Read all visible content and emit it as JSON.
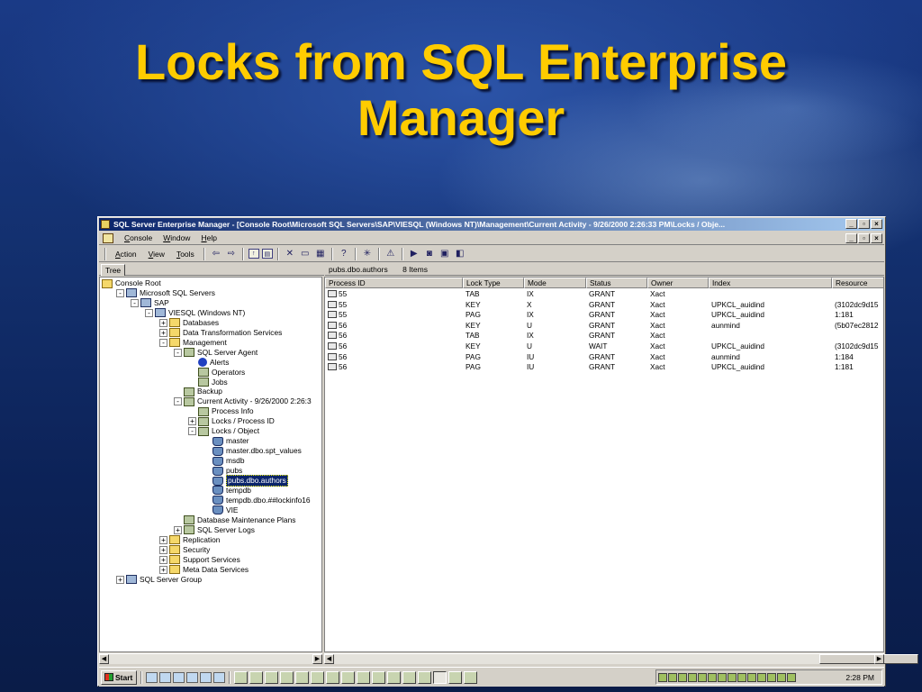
{
  "slide": {
    "title_line1": "Locks from SQL Enterprise",
    "title_line2": "Manager"
  },
  "window": {
    "title": "SQL Server Enterprise Manager - [Console Root\\Microsoft SQL Servers\\SAP\\VIESQL (Windows NT)\\Management\\Current Activity - 9/26/2000 2:26:33 PM\\Locks / Obje...",
    "menus": [
      "Console",
      "Window",
      "Help"
    ],
    "toolbar_menus": [
      "Action",
      "View",
      "Tools"
    ],
    "tree_tab": "Tree",
    "list_header": {
      "object": "pubs.dbo.authors",
      "count": "8 Items"
    }
  },
  "tree": [
    {
      "label": "Console Root",
      "depth": 0,
      "expander": "",
      "icon": "folder-icon"
    },
    {
      "label": "Microsoft SQL Servers",
      "depth": 1,
      "expander": "−",
      "icon": "server-group-icon"
    },
    {
      "label": "SAP",
      "depth": 2,
      "expander": "−",
      "icon": "server-group-icon"
    },
    {
      "label": "VIESQL (Windows NT)",
      "depth": 3,
      "expander": "−",
      "icon": "server-icon"
    },
    {
      "label": "Databases",
      "depth": 4,
      "expander": "+",
      "icon": "folder-icon"
    },
    {
      "label": "Data Transformation Services",
      "depth": 4,
      "expander": "+",
      "icon": "folder-icon"
    },
    {
      "label": "Management",
      "depth": 4,
      "expander": "−",
      "icon": "folder-icon"
    },
    {
      "label": "SQL Server Agent",
      "depth": 5,
      "expander": "−",
      "icon": "agent-icon"
    },
    {
      "label": "Alerts",
      "depth": 6,
      "expander": "",
      "icon": "alert-icon"
    },
    {
      "label": "Operators",
      "depth": 6,
      "expander": "",
      "icon": "operators-icon"
    },
    {
      "label": "Jobs",
      "depth": 6,
      "expander": "",
      "icon": "jobs-icon"
    },
    {
      "label": "Backup",
      "depth": 5,
      "expander": "",
      "icon": "backup-icon"
    },
    {
      "label": "Current Activity - 9/26/2000 2:26:3",
      "depth": 5,
      "expander": "−",
      "icon": "activity-icon"
    },
    {
      "label": "Process Info",
      "depth": 6,
      "expander": "",
      "icon": "process-info-icon"
    },
    {
      "label": "Locks / Process ID",
      "depth": 6,
      "expander": "+",
      "icon": "locks-icon"
    },
    {
      "label": "Locks / Object",
      "depth": 6,
      "expander": "−",
      "icon": "locks-icon"
    },
    {
      "label": "master",
      "depth": 7,
      "expander": "",
      "icon": "table-lock-icon"
    },
    {
      "label": "master.dbo.spt_values",
      "depth": 7,
      "expander": "",
      "icon": "table-lock-icon"
    },
    {
      "label": "msdb",
      "depth": 7,
      "expander": "",
      "icon": "table-lock-icon"
    },
    {
      "label": "pubs",
      "depth": 7,
      "expander": "",
      "icon": "table-lock-icon"
    },
    {
      "label": "pubs.dbo.authors",
      "depth": 7,
      "expander": "",
      "icon": "table-lock-icon",
      "selected": true
    },
    {
      "label": "tempdb",
      "depth": 7,
      "expander": "",
      "icon": "table-lock-icon"
    },
    {
      "label": "tempdb.dbo.##lockinfo16",
      "depth": 7,
      "expander": "",
      "icon": "table-lock-icon"
    },
    {
      "label": "VIE",
      "depth": 7,
      "expander": "",
      "icon": "table-lock-icon"
    },
    {
      "label": "Database Maintenance Plans",
      "depth": 5,
      "expander": "",
      "icon": "maintenance-icon"
    },
    {
      "label": "SQL Server Logs",
      "depth": 5,
      "expander": "+",
      "icon": "logs-icon"
    },
    {
      "label": "Replication",
      "depth": 4,
      "expander": "+",
      "icon": "folder-icon"
    },
    {
      "label": "Security",
      "depth": 4,
      "expander": "+",
      "icon": "folder-icon"
    },
    {
      "label": "Support Services",
      "depth": 4,
      "expander": "+",
      "icon": "folder-icon"
    },
    {
      "label": "Meta Data Services",
      "depth": 4,
      "expander": "+",
      "icon": "folder-icon"
    },
    {
      "label": "SQL Server Group",
      "depth": 1,
      "expander": "+",
      "icon": "server-group-icon"
    }
  ],
  "list": {
    "columns": [
      "Process ID",
      "Lock Type",
      "Mode",
      "Status",
      "Owner",
      "Index",
      "Resource"
    ],
    "rows": [
      [
        "55",
        "TAB",
        "IX",
        "GRANT",
        "Xact",
        "",
        ""
      ],
      [
        "55",
        "KEY",
        "X",
        "GRANT",
        "Xact",
        "UPKCL_auidind",
        "(3102dc9d15"
      ],
      [
        "55",
        "PAG",
        "IX",
        "GRANT",
        "Xact",
        "UPKCL_auidind",
        "1:181"
      ],
      [
        "56",
        "KEY",
        "U",
        "GRANT",
        "Xact",
        "aunmind",
        "(5b07ec2812"
      ],
      [
        "56",
        "TAB",
        "IX",
        "GRANT",
        "Xact",
        "",
        ""
      ],
      [
        "56",
        "KEY",
        "U",
        "WAIT",
        "Xact",
        "UPKCL_auidind",
        "(3102dc9d15"
      ],
      [
        "56",
        "PAG",
        "IU",
        "GRANT",
        "Xact",
        "aunmind",
        "1:184"
      ],
      [
        "56",
        "PAG",
        "IU",
        "GRANT",
        "Xact",
        "UPKCL_auidind",
        "1:181"
      ]
    ]
  },
  "taskbar": {
    "start_label": "Start",
    "clock": "2:28 PM"
  },
  "colors": {
    "title_yellow": "#ffcc00",
    "titlebar_blue": "#0a246a",
    "selection": "#0a246a"
  }
}
